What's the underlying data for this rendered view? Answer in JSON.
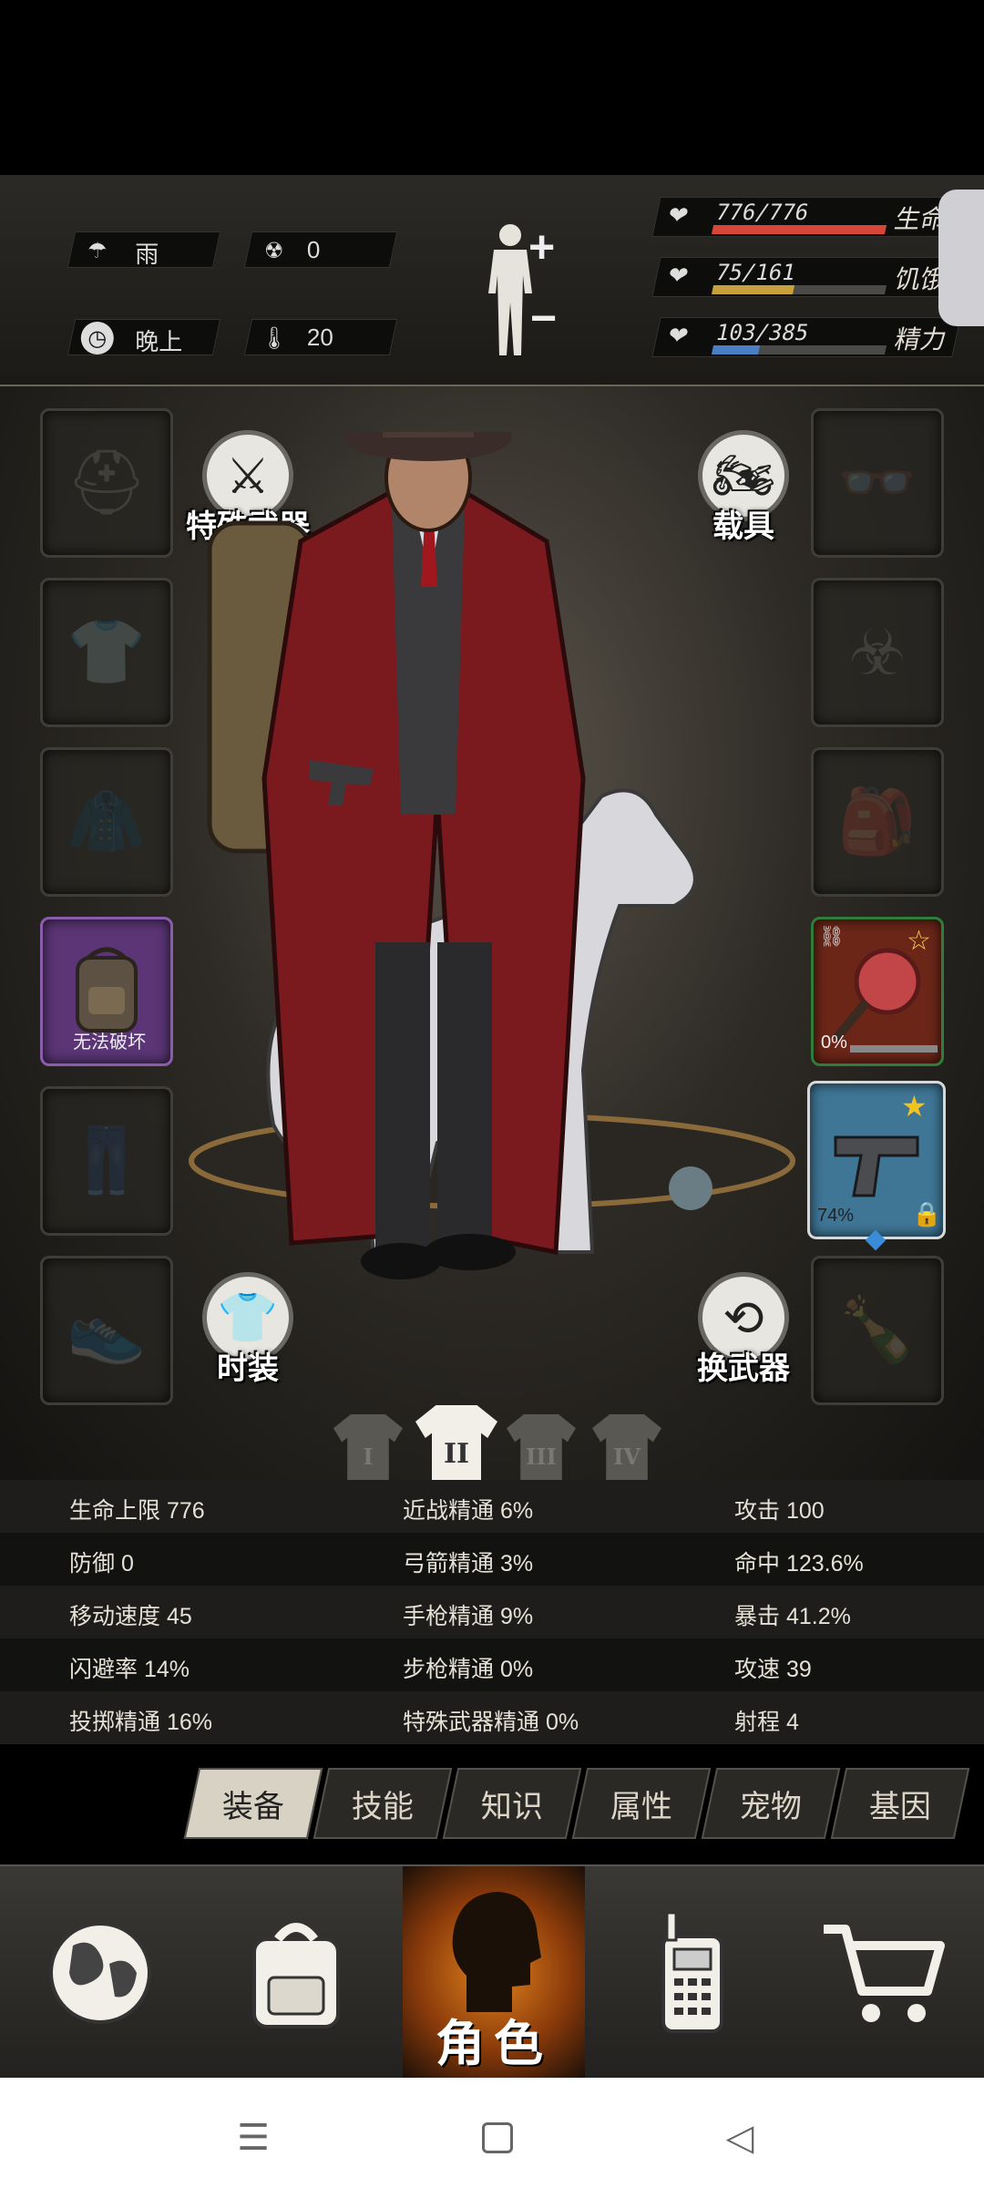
{
  "environment": {
    "weather": {
      "icon": "rain-cloud-icon",
      "value": "雨"
    },
    "radiation": {
      "icon": "radiation-icon",
      "value": "0"
    },
    "time": {
      "icon": "clock-icon",
      "value": "晚上"
    },
    "temperature": {
      "icon": "thermometer-icon",
      "value": "20"
    }
  },
  "vitals": [
    {
      "label": "生命",
      "value": "776/776",
      "fraction": 1.0,
      "color": "#d8463a",
      "icon": "heart-pulse-icon"
    },
    {
      "label": "饥饿",
      "value": "75/161",
      "fraction": 0.466,
      "color": "#c9a13a",
      "icon": "stomach-icon"
    },
    {
      "label": "精力",
      "value": "103/385",
      "fraction": 0.268,
      "color": "#4a7fc4",
      "icon": "energy-head-icon"
    }
  ],
  "equipment": {
    "special_weapon_label": "特殊武器",
    "vehicle_label": "载具",
    "outfit_label": "时装",
    "switch_weapon_label": "换武器",
    "backpack_tag": "无法破坏",
    "melee_durability": "0%",
    "pistol_durability": "74%"
  },
  "loadout_tabs": [
    "I",
    "II",
    "III",
    "IV"
  ],
  "stats": [
    [
      "生命上限 776",
      "近战精通 6%",
      "攻击 100"
    ],
    [
      "防御 0",
      "弓箭精通 3%",
      "命中 123.6%"
    ],
    [
      "移动速度 45",
      "手枪精通 9%",
      "暴击 41.2%"
    ],
    [
      "闪避率 14%",
      "步枪精通 0%",
      "攻速 39"
    ],
    [
      "投掷精通 16%",
      "特殊武器精通 0%",
      "射程 4"
    ]
  ],
  "tabs": [
    "装备",
    "技能",
    "知识",
    "属性",
    "宠物",
    "基因"
  ],
  "active_tab": "装备",
  "nav": {
    "world_icon": "globe-icon",
    "bag_icon": "backpack-icon",
    "character_label": "角色",
    "radio_icon": "walkie-talkie-icon",
    "shop_icon": "shopping-cart-icon"
  },
  "colors": {
    "accent_orange": "#e0821e",
    "purple_slot": "#5b3575",
    "green_slot": "#2f7d3a",
    "blue_slot": "#3f7696"
  }
}
